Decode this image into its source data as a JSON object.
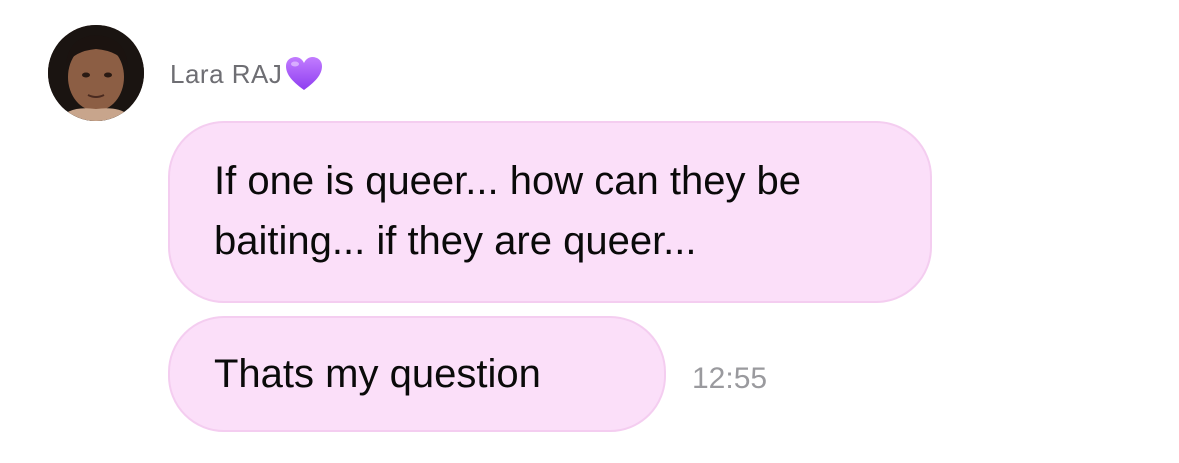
{
  "sender": {
    "name": "Lara RAJ",
    "badge_icon": "purple-heart-icon",
    "badge_color": "#a855f7"
  },
  "messages": [
    {
      "text": "If one is queer... how can they be baiting... if they are queer..."
    },
    {
      "text": "Thats my question"
    }
  ],
  "timestamp": "12:55",
  "colors": {
    "bubble_background": "#fbdff9",
    "bubble_border": "#f4cdf0",
    "sender_name": "#6e6e73",
    "timestamp": "#9a9a9e"
  }
}
